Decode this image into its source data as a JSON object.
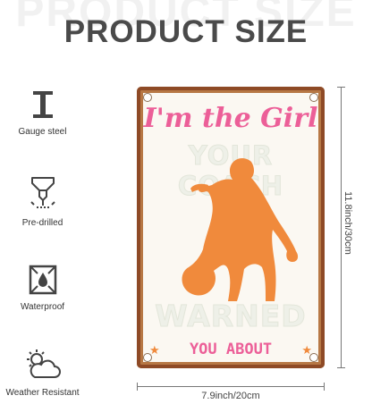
{
  "title": "PRODUCT SIZE",
  "features": [
    {
      "label": "Gauge steel",
      "icon": "i-beam-icon"
    },
    {
      "label": "Pre-drilled",
      "icon": "drill-icon"
    },
    {
      "label": "Waterproof",
      "icon": "water-drop-icon"
    },
    {
      "label": "Weather Resistant",
      "icon": "sun-cloud-icon"
    }
  ],
  "sign": {
    "line1": "I'm the Girl",
    "line2": "YOUR COACH",
    "line3": "WARNED",
    "line4": "YOU ABOUT"
  },
  "dimensions": {
    "height": "11.8inch/30cm",
    "width": "7.9inch/20cm"
  },
  "colors": {
    "accent_pink": "#ec5f98",
    "silhouette_orange": "#f08a3c",
    "rust_border": "#8e4a26"
  }
}
